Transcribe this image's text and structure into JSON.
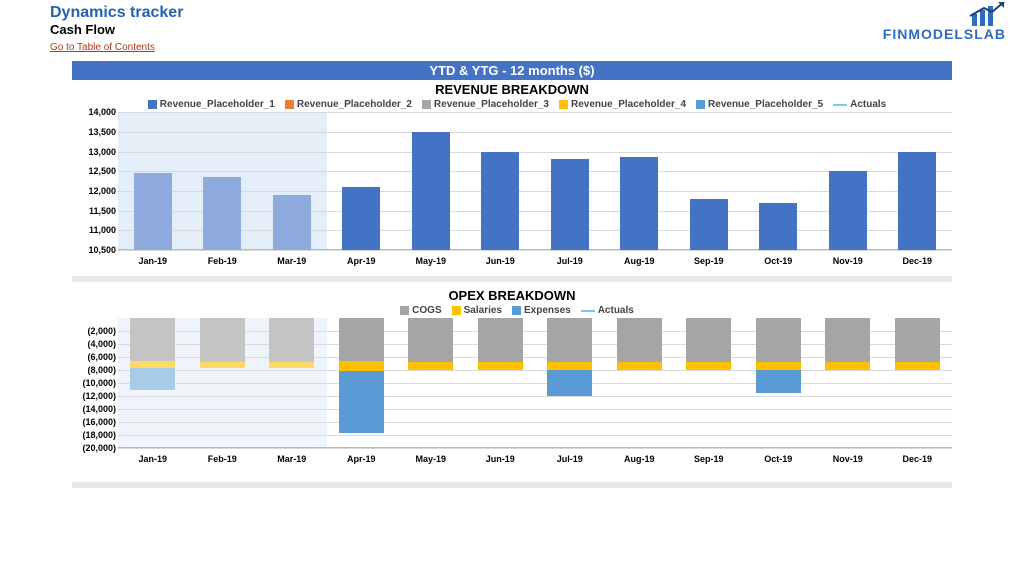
{
  "header": {
    "app_title": "Dynamics tracker",
    "sub_title": "Cash Flow",
    "toc_link": "Go to Table of Contents",
    "logo_text": "FINMODELSLAB"
  },
  "band": {
    "title": "YTD & YTG - 12 months ($)"
  },
  "colors": {
    "rev1": "#4472c4",
    "rev2": "#ed7d31",
    "rev3": "#a5a5a5",
    "rev4": "#ffc000",
    "rev5": "#5b9bd5",
    "cogs": "#a5a5a5",
    "salaries": "#ffc000",
    "expenses": "#5b9bd5",
    "actuals_bar": "#8faadc"
  },
  "chart_data": [
    {
      "id": "revenue",
      "title": "REVENUE BREAKDOWN",
      "type": "bar",
      "legend": [
        {
          "key": "rev1",
          "label": "Revenue_Placeholder_1"
        },
        {
          "key": "rev2",
          "label": "Revenue_Placeholder_2"
        },
        {
          "key": "rev3",
          "label": "Revenue_Placeholder_3"
        },
        {
          "key": "rev4",
          "label": "Revenue_Placeholder_4"
        },
        {
          "key": "rev5",
          "label": "Revenue_Placeholder_5"
        },
        {
          "key": "actuals",
          "label": "Actuals",
          "line": true
        }
      ],
      "categories": [
        "Jan-19",
        "Feb-19",
        "Mar-19",
        "Apr-19",
        "May-19",
        "Jun-19",
        "Jul-19",
        "Aug-19",
        "Sep-19",
        "Oct-19",
        "Nov-19",
        "Dec-19"
      ],
      "ylim": [
        10500,
        14000
      ],
      "yticks": [
        10500,
        11000,
        11500,
        12000,
        12500,
        13000,
        13500,
        14000
      ],
      "values": [
        12450,
        12350,
        11900,
        12100,
        13500,
        13000,
        12800,
        12850,
        11800,
        11700,
        12500,
        13000
      ],
      "actuals_months": 3
    },
    {
      "id": "opex",
      "title": "OPEX BREAKDOWN",
      "type": "bar",
      "stacked": true,
      "legend": [
        {
          "key": "cogs",
          "label": "COGS"
        },
        {
          "key": "salaries",
          "label": "Salaries"
        },
        {
          "key": "expenses",
          "label": "Expenses"
        },
        {
          "key": "actuals",
          "label": "Actuals",
          "line": true
        }
      ],
      "categories": [
        "Jan-19",
        "Feb-19",
        "Mar-19",
        "Apr-19",
        "May-19",
        "Jun-19",
        "Jul-19",
        "Aug-19",
        "Sep-19",
        "Oct-19",
        "Nov-19",
        "Dec-19"
      ],
      "ylim": [
        -20000,
        0
      ],
      "yticks": [
        -20000,
        -18000,
        -16000,
        -14000,
        -12000,
        -10000,
        -8000,
        -6000,
        -4000,
        -2000
      ],
      "series": [
        {
          "name": "COGS",
          "key": "cogs",
          "values": [
            -6500,
            -6700,
            -6700,
            -6500,
            -6800,
            -6800,
            -6700,
            -6800,
            -6800,
            -6800,
            -6800,
            -6800
          ]
        },
        {
          "name": "Salaries",
          "key": "salaries",
          "values": [
            -1200,
            -1000,
            -1000,
            -1600,
            -1200,
            -1200,
            -1300,
            -1200,
            -1200,
            -1200,
            -1200,
            -1200
          ]
        },
        {
          "name": "Expenses",
          "key": "expenses",
          "values": [
            -3400,
            0,
            0,
            -9600,
            0,
            0,
            -4000,
            0,
            0,
            -3500,
            0,
            0
          ]
        }
      ],
      "actuals_months": 3
    }
  ]
}
